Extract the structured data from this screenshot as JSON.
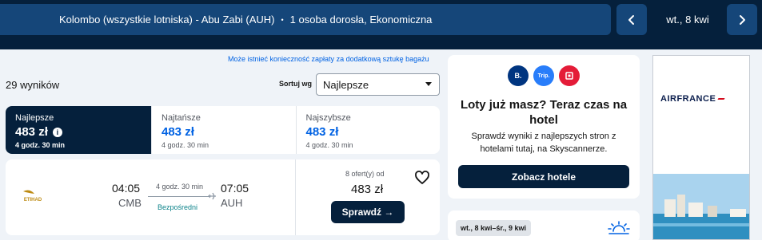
{
  "search_bar": {
    "route": "Kolombo (wszystkie lotniska) - Abu Zabi (AUH)",
    "separator": "•",
    "passengers": "1 osoba dorosła, Ekonomiczna",
    "date": "wt., 8 kwi",
    "prev_icon": "chevron-left-icon",
    "next_icon": "chevron-right-icon"
  },
  "fee_notice": "Może istnieć konieczność zapłaty za dodatkową sztukę bagażu",
  "results": {
    "count": "29 wyników",
    "sort_label": "Sortuj wg",
    "sort_value": "Najlepsze"
  },
  "tabs": [
    {
      "label": "Najlepsze",
      "price": "483 zł",
      "duration": "4 godz. 30 min",
      "active": true
    },
    {
      "label": "Najtańsze",
      "price": "483 zł",
      "duration": "4 godz. 30 min",
      "active": false
    },
    {
      "label": "Najszybsze",
      "price": "483 zł",
      "duration": "4 godz. 30 min",
      "active": false
    }
  ],
  "flight": {
    "airline_logo": "etihad-logo",
    "airline_text": "ETIHAD",
    "departure_time": "04:05",
    "departure_code": "CMB",
    "arrival_time": "07:05",
    "arrival_code": "AUH",
    "duration": "4 godz. 30 min",
    "stops": "Bezpośredni",
    "offers": "8 ofert(y) od",
    "price": "483 zł",
    "select_label": "Sprawdź →"
  },
  "hotel_promo": {
    "partners": [
      {
        "name": "B.",
        "color": "#003580"
      },
      {
        "name": "Trip.",
        "color": "#287dfa"
      },
      {
        "name": "",
        "color": "#e41c38"
      }
    ],
    "title": "Loty już masz? Teraz czas na hotel",
    "subtitle": "Sprawdź wyniki z najlepszych stron z hotelami tutaj, na Skyscannerze.",
    "button": "Zobacz hotele"
  },
  "deal": {
    "dates": "wt., 8 kwi–śr., 9 kwi",
    "icon": "sun-icon"
  },
  "ad": {
    "brand": "AIRFRANCE"
  },
  "colors": {
    "navy": "#05203c",
    "route_bg": "#154679",
    "accent_blue": "#0062e3",
    "direct_green": "#0c838a"
  }
}
